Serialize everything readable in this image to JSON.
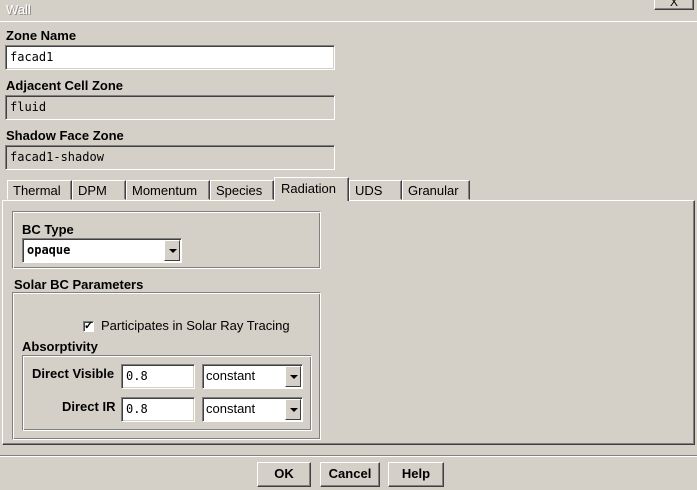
{
  "window": {
    "title": "Wall",
    "close_label": "X"
  },
  "fields": {
    "zone_name": {
      "label": "Zone Name",
      "value": "facad1"
    },
    "adjacent_cell_zone": {
      "label": "Adjacent Cell Zone",
      "value": "fluid"
    },
    "shadow_face_zone": {
      "label": "Shadow Face Zone",
      "value": "facad1-shadow"
    }
  },
  "tabs": [
    {
      "label": "Thermal"
    },
    {
      "label": "DPM"
    },
    {
      "label": "Momentum"
    },
    {
      "label": "Species"
    },
    {
      "label": "Radiation",
      "active": true
    },
    {
      "label": "UDS"
    },
    {
      "label": "Granular"
    }
  ],
  "radiation": {
    "bc_type_label": "BC Type",
    "bc_type_value": "opaque",
    "solar_params_label": "Solar BC Parameters",
    "participates_label": "Participates in Solar Ray Tracing",
    "participates_checked": true,
    "absorptivity_label": "Absorptivity",
    "direct_visible": {
      "label": "Direct Visible",
      "value": "0.8",
      "method": "constant"
    },
    "direct_ir": {
      "label": "Direct IR",
      "value": "0.8",
      "method": "constant"
    }
  },
  "buttons": {
    "ok": "OK",
    "cancel": "Cancel",
    "help": "Help"
  }
}
